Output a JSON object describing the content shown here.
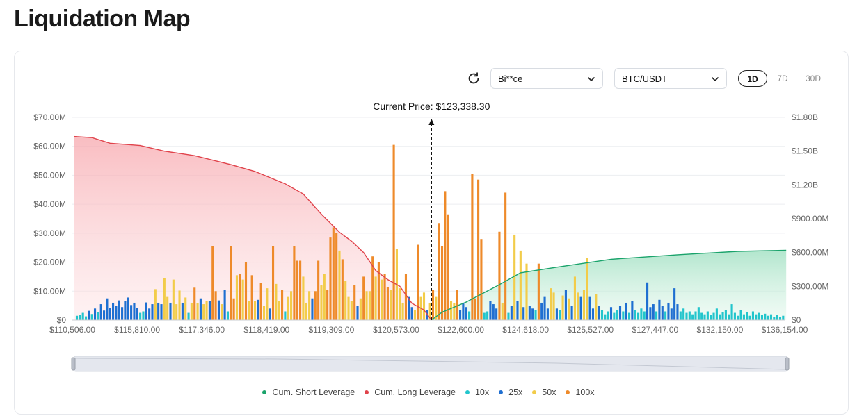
{
  "page": {
    "title": "Liquidation Map"
  },
  "controls": {
    "exchange": "Bi**ce",
    "pair": "BTC/USDT",
    "ranges": [
      "1D",
      "7D",
      "30D"
    ],
    "active_range": "1D"
  },
  "colors": {
    "short": "#1aa36b",
    "long": "#e0434b",
    "x10": "#22c5cc",
    "x25": "#1f6fd1",
    "x50": "#f2cc4a",
    "x100": "#ee8a2a"
  },
  "chart_data": {
    "type": "bar",
    "current_price_label": "Current Price: $123,338.30",
    "current_price_category": 118.5,
    "x_tick_labels": [
      "$110,506.00",
      "$115,810.00",
      "$117,346.00",
      "$118,419.00",
      "$119,309.00",
      "$120,573.00",
      "$122,600.00",
      "$124,618.00",
      "$125,527.00",
      "$127,447.00",
      "$132,150.00",
      "$136,154.00"
    ],
    "y_left": {
      "ticks": [
        "$0",
        "$10.00M",
        "$20.00M",
        "$30.00M",
        "$40.00M",
        "$50.00M",
        "$60.00M",
        "$70.00M"
      ],
      "min": 0,
      "max": 70
    },
    "y_right": {
      "ticks": [
        "$0",
        "$300.00M",
        "$600.00M",
        "$900.00M",
        "$1.20B",
        "$1.50B",
        "$1.80B"
      ],
      "min": 0,
      "max": 1800
    },
    "legend": [
      {
        "key": "short",
        "label": "Cum. Short Leverage"
      },
      {
        "key": "long",
        "label": "Cum. Long Leverage"
      },
      {
        "key": "x10",
        "label": "10x"
      },
      {
        "key": "x25",
        "label": "25x"
      },
      {
        "key": "x50",
        "label": "50x"
      },
      {
        "key": "x100",
        "label": "100x"
      }
    ],
    "cum_long_series": [
      [
        0,
        1630
      ],
      [
        6,
        1620
      ],
      [
        12,
        1570
      ],
      [
        22,
        1550
      ],
      [
        30,
        1500
      ],
      [
        40,
        1460
      ],
      [
        52,
        1380
      ],
      [
        60,
        1320
      ],
      [
        70,
        1210
      ],
      [
        76,
        1120
      ],
      [
        82,
        940
      ],
      [
        88,
        780
      ],
      [
        92,
        700
      ],
      [
        96,
        600
      ],
      [
        100,
        440
      ],
      [
        104,
        360
      ],
      [
        108,
        300
      ],
      [
        112,
        150
      ],
      [
        116,
        90
      ],
      [
        118.5,
        0
      ]
    ],
    "cum_short_series": [
      [
        118.5,
        0
      ],
      [
        122,
        70
      ],
      [
        130,
        160
      ],
      [
        140,
        300
      ],
      [
        148,
        420
      ],
      [
        160,
        470
      ],
      [
        178,
        540
      ],
      [
        200,
        580
      ],
      [
        220,
        610
      ],
      [
        236,
        620
      ]
    ],
    "bars": [
      [
        1,
        1.5,
        "x10"
      ],
      [
        2,
        1.8,
        "x10"
      ],
      [
        3,
        2.5,
        "x10"
      ],
      [
        4,
        1.3,
        "x10"
      ],
      [
        5,
        3.2,
        "x25"
      ],
      [
        6,
        2.1,
        "x10"
      ],
      [
        7,
        4.0,
        "x25"
      ],
      [
        8,
        2.8,
        "x10"
      ],
      [
        9,
        5.5,
        "x25"
      ],
      [
        10,
        3.3,
        "x25"
      ],
      [
        11,
        7.5,
        "x25"
      ],
      [
        12,
        4.2,
        "x25"
      ],
      [
        13,
        6.0,
        "x25"
      ],
      [
        14,
        5.0,
        "x25"
      ],
      [
        15,
        6.8,
        "x25"
      ],
      [
        16,
        4.5,
        "x25"
      ],
      [
        17,
        6.5,
        "x25"
      ],
      [
        18,
        7.8,
        "x25"
      ],
      [
        19,
        5.2,
        "x25"
      ],
      [
        20,
        6.0,
        "x25"
      ],
      [
        21,
        4.1,
        "x25"
      ],
      [
        22,
        2.5,
        "x10"
      ],
      [
        23,
        3.0,
        "x10"
      ],
      [
        24,
        6.1,
        "x25"
      ],
      [
        25,
        4.0,
        "x25"
      ],
      [
        26,
        5.5,
        "x25"
      ],
      [
        27,
        10.7,
        "x50"
      ],
      [
        28,
        6.0,
        "x25"
      ],
      [
        29,
        5.5,
        "x25"
      ],
      [
        30,
        14.5,
        "x50"
      ],
      [
        31,
        8.0,
        "x50"
      ],
      [
        32,
        6.0,
        "x25"
      ],
      [
        33,
        14.0,
        "x50"
      ],
      [
        34,
        5.5,
        "x50"
      ],
      [
        35,
        10.2,
        "x50"
      ],
      [
        36,
        6.0,
        "x25"
      ],
      [
        37,
        7.8,
        "x50"
      ],
      [
        38,
        2.5,
        "x10"
      ],
      [
        39,
        6.0,
        "x50"
      ],
      [
        40,
        11.2,
        "x100"
      ],
      [
        41,
        5.8,
        "x50"
      ],
      [
        42,
        7.5,
        "x25"
      ],
      [
        43,
        5.5,
        "x50"
      ],
      [
        44,
        6.5,
        "x50"
      ],
      [
        45,
        6.5,
        "x25"
      ],
      [
        46,
        25.5,
        "x100"
      ],
      [
        47,
        10.0,
        "x100"
      ],
      [
        48,
        6.8,
        "x25"
      ],
      [
        49,
        5.5,
        "x50"
      ],
      [
        50,
        10.5,
        "x25"
      ],
      [
        51,
        3.0,
        "x10"
      ],
      [
        52,
        25.5,
        "x100"
      ],
      [
        53,
        7.5,
        "x100"
      ],
      [
        54,
        15.5,
        "x50"
      ],
      [
        55,
        16.0,
        "x100"
      ],
      [
        56,
        14.0,
        "x50"
      ],
      [
        57,
        20.0,
        "x100"
      ],
      [
        58,
        6.5,
        "x50"
      ],
      [
        59,
        15.5,
        "x100"
      ],
      [
        60,
        6.5,
        "x50"
      ],
      [
        61,
        7.0,
        "x25"
      ],
      [
        62,
        12.8,
        "x100"
      ],
      [
        63,
        5.0,
        "x50"
      ],
      [
        64,
        11.0,
        "x50"
      ],
      [
        65,
        4.0,
        "x25"
      ],
      [
        66,
        25.5,
        "x100"
      ],
      [
        67,
        12.5,
        "x50"
      ],
      [
        68,
        6.5,
        "x50"
      ],
      [
        69,
        10.5,
        "x100"
      ],
      [
        70,
        3.0,
        "x10"
      ],
      [
        71,
        8.0,
        "x50"
      ],
      [
        72,
        10.0,
        "x50"
      ],
      [
        73,
        25.5,
        "x100"
      ],
      [
        74,
        20.5,
        "x100"
      ],
      [
        75,
        20.5,
        "x100"
      ],
      [
        76,
        15.0,
        "x50"
      ],
      [
        77,
        6.0,
        "x50"
      ],
      [
        78,
        10.0,
        "x50"
      ],
      [
        79,
        7.5,
        "x25"
      ],
      [
        80,
        10.0,
        "x100"
      ],
      [
        81,
        20.5,
        "x100"
      ],
      [
        82,
        12.0,
        "x50"
      ],
      [
        83,
        16.0,
        "x50"
      ],
      [
        84,
        10.5,
        "x100"
      ],
      [
        85,
        28.5,
        "x100"
      ],
      [
        86,
        32.0,
        "x100"
      ],
      [
        87,
        30.0,
        "x100"
      ],
      [
        88,
        24.0,
        "x50"
      ],
      [
        89,
        21.0,
        "x100"
      ],
      [
        90,
        13.5,
        "x50"
      ],
      [
        91,
        8.0,
        "x50"
      ],
      [
        92,
        6.5,
        "x50"
      ],
      [
        93,
        12.0,
        "x100"
      ],
      [
        94,
        5.0,
        "x25"
      ],
      [
        95,
        7.5,
        "x50"
      ],
      [
        96,
        15.0,
        "x100"
      ],
      [
        97,
        10.0,
        "x50"
      ],
      [
        98,
        10.0,
        "x50"
      ],
      [
        99,
        22.0,
        "x100"
      ],
      [
        100,
        15.0,
        "x50"
      ],
      [
        101,
        20.0,
        "x100"
      ],
      [
        102,
        14.0,
        "x50"
      ],
      [
        103,
        16.0,
        "x100"
      ],
      [
        104,
        11.5,
        "x100"
      ],
      [
        105,
        10.5,
        "x50"
      ],
      [
        106,
        60.5,
        "x100"
      ],
      [
        107,
        24.5,
        "x50"
      ],
      [
        108,
        11.0,
        "x50"
      ],
      [
        109,
        6.0,
        "x50"
      ],
      [
        110,
        16.0,
        "x100"
      ],
      [
        111,
        8.0,
        "x25"
      ],
      [
        112,
        4.5,
        "x25"
      ],
      [
        113,
        3.5,
        "x50"
      ],
      [
        114,
        26.0,
        "x100"
      ],
      [
        115,
        8.0,
        "x50"
      ],
      [
        116,
        9.5,
        "x50"
      ],
      [
        117,
        3.5,
        "x25"
      ],
      [
        118,
        6.0,
        "x50"
      ],
      [
        119,
        10.5,
        "x100"
      ],
      [
        120,
        8.0,
        "x50"
      ],
      [
        121,
        33.5,
        "x100"
      ],
      [
        122,
        25.5,
        "x100"
      ],
      [
        123,
        44.5,
        "x100"
      ],
      [
        124,
        36.5,
        "x100"
      ],
      [
        125,
        6.5,
        "x50"
      ],
      [
        126,
        6.0,
        "x50"
      ],
      [
        127,
        10.5,
        "x100"
      ],
      [
        128,
        3.5,
        "x25"
      ],
      [
        129,
        6.0,
        "x25"
      ],
      [
        130,
        4.5,
        "x25"
      ],
      [
        131,
        3.0,
        "x10"
      ],
      [
        132,
        50.5,
        "x100"
      ],
      [
        133,
        7.5,
        "x100"
      ],
      [
        134,
        48.5,
        "x100"
      ],
      [
        135,
        28.0,
        "x100"
      ],
      [
        136,
        2.5,
        "x10"
      ],
      [
        137,
        3.0,
        "x10"
      ],
      [
        138,
        6.5,
        "x25"
      ],
      [
        139,
        5.5,
        "x25"
      ],
      [
        140,
        4.0,
        "x25"
      ],
      [
        141,
        30.5,
        "x100"
      ],
      [
        142,
        6.0,
        "x50"
      ],
      [
        143,
        44.0,
        "x100"
      ],
      [
        144,
        2.5,
        "x10"
      ],
      [
        145,
        5.0,
        "x25"
      ],
      [
        146,
        29.5,
        "x50"
      ],
      [
        147,
        6.5,
        "x25"
      ],
      [
        148,
        24.0,
        "x50"
      ],
      [
        149,
        4.5,
        "x25"
      ],
      [
        150,
        19.5,
        "x50"
      ],
      [
        151,
        5.0,
        "x25"
      ],
      [
        152,
        4.0,
        "x25"
      ],
      [
        153,
        3.5,
        "x10"
      ],
      [
        154,
        19.5,
        "x100"
      ],
      [
        155,
        6.0,
        "x25"
      ],
      [
        156,
        8.0,
        "x25"
      ],
      [
        157,
        4.0,
        "x25"
      ],
      [
        158,
        11.0,
        "x50"
      ],
      [
        159,
        9.5,
        "x50"
      ],
      [
        160,
        4.0,
        "x25"
      ],
      [
        161,
        3.5,
        "x10"
      ],
      [
        162,
        8.5,
        "x50"
      ],
      [
        163,
        10.5,
        "x25"
      ],
      [
        164,
        7.5,
        "x50"
      ],
      [
        165,
        5.0,
        "x25"
      ],
      [
        166,
        15.0,
        "x50"
      ],
      [
        167,
        9.5,
        "x50"
      ],
      [
        168,
        8.0,
        "x25"
      ],
      [
        169,
        10.5,
        "x50"
      ],
      [
        170,
        21.5,
        "x50"
      ],
      [
        171,
        8.0,
        "x25"
      ],
      [
        172,
        4.0,
        "x25"
      ],
      [
        173,
        9.0,
        "x50"
      ],
      [
        174,
        5.0,
        "x25"
      ],
      [
        175,
        3.5,
        "x10"
      ],
      [
        176,
        2.0,
        "x10"
      ],
      [
        177,
        3.0,
        "x10"
      ],
      [
        178,
        4.5,
        "x25"
      ],
      [
        179,
        2.5,
        "x10"
      ],
      [
        180,
        3.5,
        "x10"
      ],
      [
        181,
        5.0,
        "x25"
      ],
      [
        182,
        3.0,
        "x10"
      ],
      [
        183,
        6.0,
        "x25"
      ],
      [
        184,
        2.5,
        "x10"
      ],
      [
        185,
        6.5,
        "x25"
      ],
      [
        186,
        3.5,
        "x10"
      ],
      [
        187,
        2.5,
        "x10"
      ],
      [
        188,
        4.0,
        "x10"
      ],
      [
        189,
        3.0,
        "x10"
      ],
      [
        190,
        13.0,
        "x25"
      ],
      [
        191,
        4.5,
        "x25"
      ],
      [
        192,
        5.5,
        "x25"
      ],
      [
        193,
        3.0,
        "x10"
      ],
      [
        194,
        7.0,
        "x25"
      ],
      [
        195,
        5.0,
        "x25"
      ],
      [
        196,
        3.0,
        "x10"
      ],
      [
        197,
        6.0,
        "x25"
      ],
      [
        198,
        4.0,
        "x25"
      ],
      [
        199,
        11.0,
        "x25"
      ],
      [
        200,
        5.5,
        "x25"
      ],
      [
        201,
        3.0,
        "x10"
      ],
      [
        202,
        4.0,
        "x10"
      ],
      [
        203,
        2.5,
        "x10"
      ],
      [
        204,
        3.0,
        "x10"
      ],
      [
        205,
        2.0,
        "x10"
      ],
      [
        206,
        3.0,
        "x10"
      ],
      [
        207,
        4.5,
        "x10"
      ],
      [
        208,
        2.5,
        "x10"
      ],
      [
        209,
        2.0,
        "x10"
      ],
      [
        210,
        3.0,
        "x10"
      ],
      [
        211,
        1.8,
        "x10"
      ],
      [
        212,
        2.5,
        "x10"
      ],
      [
        213,
        4.0,
        "x10"
      ],
      [
        214,
        2.0,
        "x10"
      ],
      [
        215,
        2.8,
        "x10"
      ],
      [
        216,
        3.5,
        "x10"
      ],
      [
        217,
        2.0,
        "x10"
      ],
      [
        218,
        5.5,
        "x10"
      ],
      [
        219,
        2.5,
        "x10"
      ],
      [
        220,
        1.5,
        "x10"
      ],
      [
        221,
        3.5,
        "x10"
      ],
      [
        222,
        2.0,
        "x10"
      ],
      [
        223,
        2.8,
        "x10"
      ],
      [
        224,
        1.5,
        "x10"
      ],
      [
        225,
        3.0,
        "x10"
      ],
      [
        226,
        2.0,
        "x10"
      ],
      [
        227,
        2.5,
        "x10"
      ],
      [
        228,
        1.8,
        "x10"
      ],
      [
        229,
        2.2,
        "x10"
      ],
      [
        230,
        1.5,
        "x10"
      ],
      [
        231,
        2.0,
        "x10"
      ],
      [
        232,
        1.2,
        "x10"
      ],
      [
        233,
        1.8,
        "x10"
      ],
      [
        234,
        1.0,
        "x10"
      ],
      [
        235,
        1.5,
        "x10"
      ]
    ]
  }
}
